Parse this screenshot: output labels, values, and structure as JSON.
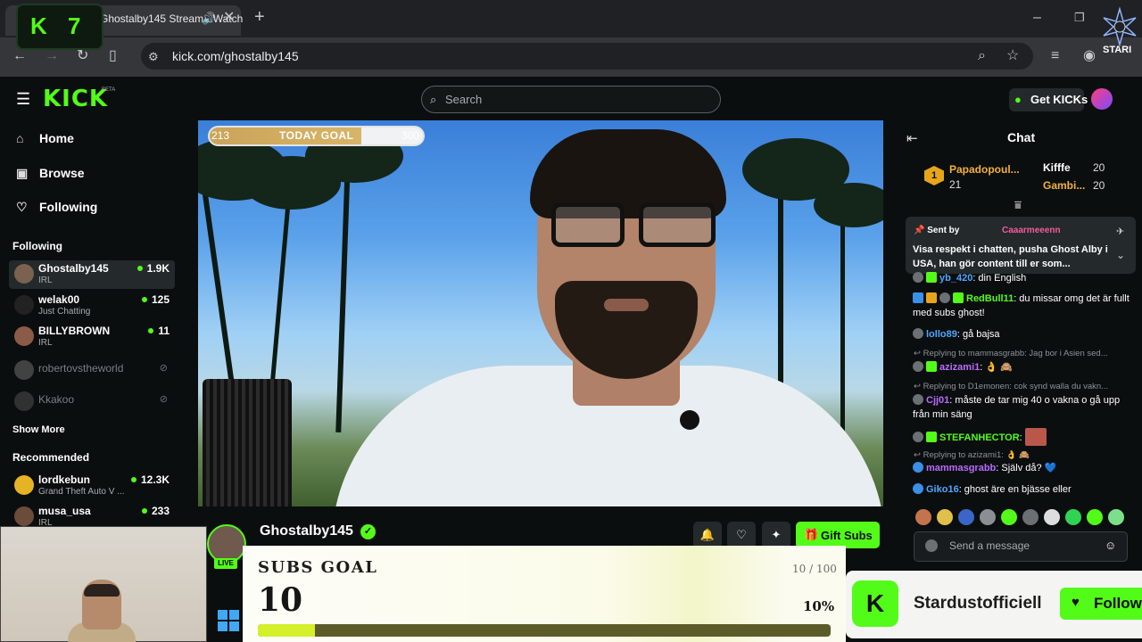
{
  "browser": {
    "tab_title": "Ghostalby145 Stream - Watch",
    "url": "kick.com/ghostalby145",
    "overlay_badge": {
      "letter": "K",
      "number": "7"
    },
    "extension_label": "STARI"
  },
  "nav": {
    "logo": "KICK",
    "beta": "BETA",
    "search_placeholder": "Search",
    "get_kicks": "Get KICKs"
  },
  "sidebar": {
    "home": "Home",
    "browse": "Browse",
    "following": "Following",
    "following_header": "Following",
    "following_list": [
      {
        "name": "Ghostalby145",
        "category": "IRL",
        "viewers": "1.9K"
      },
      {
        "name": "welak00",
        "category": "Just Chatting",
        "viewers": "125"
      },
      {
        "name": "BILLYBROWN",
        "category": "IRL",
        "viewers": "11"
      },
      {
        "name": "robertovstheworld",
        "category": "",
        "viewers": ""
      },
      {
        "name": "Kkakoo",
        "category": "",
        "viewers": ""
      }
    ],
    "show_more": "Show More",
    "recommended_header": "Recommended",
    "recommended_list": [
      {
        "name": "lordkebun",
        "category": "Grand Theft Auto V ...",
        "viewers": "12.3K"
      },
      {
        "name": "musa_usa",
        "category": "IRL",
        "viewers": "233"
      }
    ]
  },
  "video_overlay": {
    "goal_current": "213",
    "goal_label": "TODAY GOAL",
    "goal_target": "300",
    "goal_fraction": 0.71
  },
  "stream": {
    "streamer": "Ghostalby145",
    "live": "LIVE",
    "gift_subs": "Gift Subs"
  },
  "subs_goal": {
    "title": "SUBS GOAL",
    "ratio": "10 / 100",
    "count": "10",
    "percent": "10%",
    "fraction": 0.1
  },
  "chat": {
    "title": "Chat",
    "leaderboard": [
      {
        "rank": "1",
        "name": "Papadopoul...",
        "count": "21"
      },
      {
        "name": "Kifffe",
        "count": "20"
      },
      {
        "name": "Gambi...",
        "count": "20"
      }
    ],
    "pinned": {
      "sent_by": "Sent by",
      "user": "Caaarmeeenn",
      "message": "Visa respekt i chatten, pusha Ghost Alby i USA, han gör content till er som..."
    },
    "messages": [
      {
        "user": "yb_420",
        "text": ": din English",
        "color": "#4fa6ff"
      },
      {
        "user": "RedBull11",
        "text": ": du missar omg det är fullt med subs ghost!",
        "color": "#53fc18"
      },
      {
        "user": "lollo89",
        "text": ": gå bajsa",
        "color": "#4fa6ff"
      },
      {
        "reply": "Replying to mammasgrabb: Jag bor i Asien sed...",
        "user": "azizami1",
        "text": ": 👌 🙈",
        "color": "#bb6bff"
      },
      {
        "reply": "Replying to D1emonen: cok synd walla du vakn...",
        "user": "Cjj01",
        "text": ": måste de tar mig 40 o vakna o gå upp från min säng",
        "color": "#bb6bff"
      },
      {
        "user": "STEFANHECTOR",
        "text": ":",
        "color": "#53fc18"
      },
      {
        "reply": "Replying to azizami1: 👌 🙈",
        "user": "mammasgrabb",
        "text": ": Själv då? 💙",
        "color": "#bb6bff"
      },
      {
        "user": "Giko16",
        "text": ": ghost äre en bjässe eller",
        "color": "#4fa6ff"
      }
    ],
    "input_placeholder": "Send a message"
  },
  "follow_popup": {
    "channel": "Stardustofficiell",
    "button": "Follow"
  },
  "colors": {
    "kick_green": "#53fc18",
    "bg": "#0b0e0f",
    "panel": "#24292b"
  }
}
